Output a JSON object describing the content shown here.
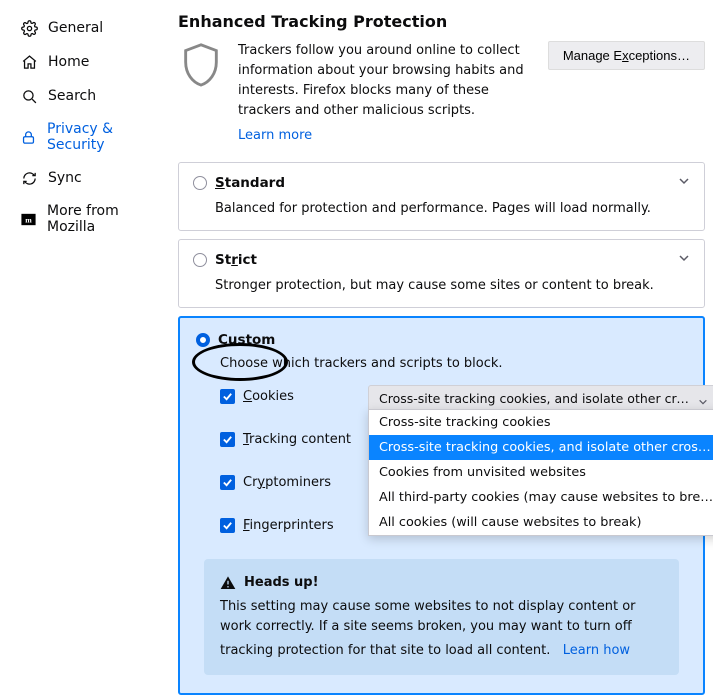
{
  "sidebar": {
    "items": [
      {
        "label": "General"
      },
      {
        "label": "Home"
      },
      {
        "label": "Search"
      },
      {
        "label": "Privacy & Security"
      },
      {
        "label": "Sync"
      },
      {
        "label": "More from Mozilla"
      }
    ]
  },
  "title": "Enhanced Tracking Protection",
  "intro": {
    "text": "Trackers follow you around online to collect information about your browsing habits and interests. Firefox blocks many of these trackers and other malicious scripts.",
    "learn_more": "Learn more",
    "manage_btn": "Manage Exceptions…"
  },
  "options": {
    "standard": {
      "label": "Standard",
      "desc": "Balanced for protection and performance. Pages will load normally."
    },
    "strict": {
      "label": "Strict",
      "desc": "Stronger protection, but may cause some sites or content to break."
    },
    "custom": {
      "label": "Custom",
      "desc": "Choose which trackers and scripts to block.",
      "checks": {
        "cookies": "Cookies",
        "tracking": "Tracking content",
        "crypto": "Cryptominers",
        "finger": "Fingerprinters"
      },
      "cookies_select": "Cross-site tracking cookies, and isolate other cross-site co…",
      "cookies_menu": [
        "Cross-site tracking cookies",
        "Cross-site tracking cookies, and isolate other cross-site cookies",
        "Cookies from unvisited websites",
        "All third-party cookies (may cause websites to break)",
        "All cookies (will cause websites to break)"
      ],
      "heads_up": {
        "title": "Heads up!",
        "body": "This setting may cause some websites to not display content or work correctly. If a site seems broken, you may want to turn off tracking protection for that site to load all content.",
        "learn": "Learn how"
      }
    }
  }
}
